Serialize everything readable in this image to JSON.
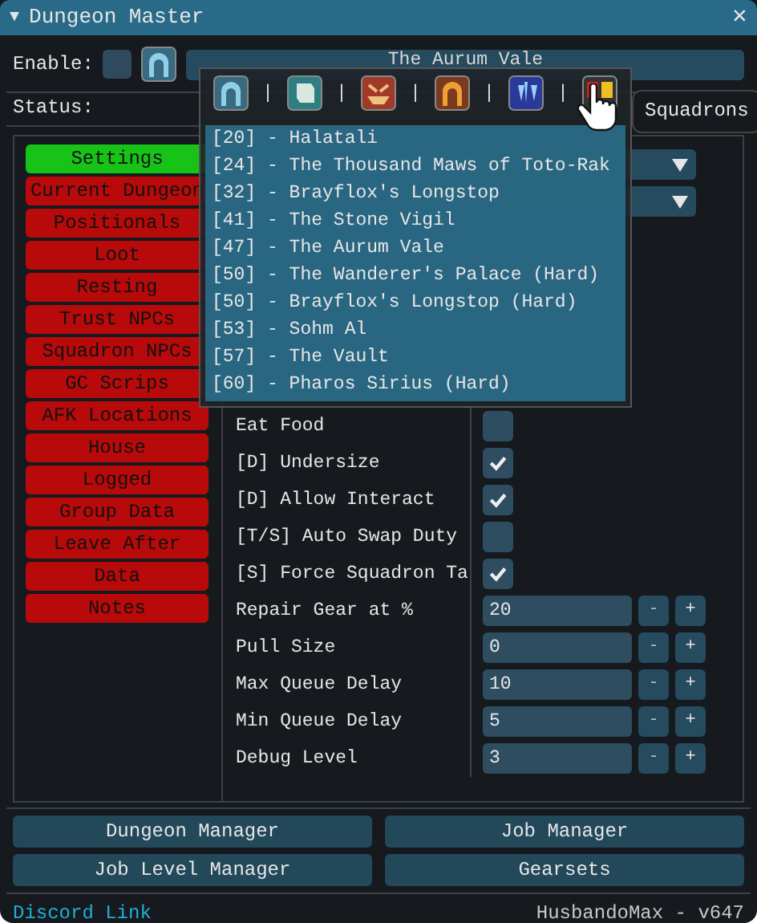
{
  "window": {
    "title": "Dungeon Master",
    "close": "×",
    "collapse": "▼"
  },
  "enable": {
    "label": "Enable:",
    "checked": false,
    "dungeon": "The Aurum Vale"
  },
  "status": {
    "label": "Status:"
  },
  "sidebar": [
    {
      "label": "Settings",
      "selected": true
    },
    {
      "label": "Current Dungeon",
      "selected": false
    },
    {
      "label": "Positionals",
      "selected": false
    },
    {
      "label": "Loot",
      "selected": false
    },
    {
      "label": "Resting",
      "selected": false
    },
    {
      "label": "Trust NPCs",
      "selected": false
    },
    {
      "label": "Squadron NPCs",
      "selected": false
    },
    {
      "label": "GC Scrips",
      "selected": false
    },
    {
      "label": "AFK Locations",
      "selected": false
    },
    {
      "label": "House",
      "selected": false
    },
    {
      "label": "Logged",
      "selected": false
    },
    {
      "label": "Group Data",
      "selected": false
    },
    {
      "label": "Leave After",
      "selected": false
    },
    {
      "label": "Data",
      "selected": false
    },
    {
      "label": "Notes",
      "selected": false
    }
  ],
  "settings": [
    {
      "kind": "checkbox",
      "label": "Eat Food",
      "checked": false
    },
    {
      "kind": "checkbox",
      "label": "[D] Undersize",
      "checked": true
    },
    {
      "kind": "checkbox",
      "label": "[D] Allow Interact",
      "checked": true
    },
    {
      "kind": "checkbox",
      "label": "[T/S] Auto Swap Duty",
      "checked": false
    },
    {
      "kind": "checkbox",
      "label": "[S] Force Squadron Ta",
      "checked": true
    },
    {
      "kind": "number",
      "label": "Repair Gear at %",
      "value": "20",
      "minus": "-",
      "plus": "+"
    },
    {
      "kind": "number",
      "label": "Pull Size",
      "value": "0",
      "minus": "-",
      "plus": "+"
    },
    {
      "kind": "number",
      "label": "Max Queue Delay",
      "value": "10",
      "minus": "-",
      "plus": "+"
    },
    {
      "kind": "number",
      "label": "Min Queue Delay",
      "value": "5",
      "minus": "-",
      "plus": "+"
    },
    {
      "kind": "number",
      "label": "Debug Level",
      "value": "3",
      "minus": "-",
      "plus": "+"
    }
  ],
  "popup": {
    "separators": [
      "|",
      "|",
      "|",
      "|",
      "|"
    ],
    "dungeons": [
      "[20] - Halatali",
      "[24] - The Thousand Maws of Toto-Rak",
      "[32] - Brayflox's Longstop",
      "[41] - The Stone Vigil",
      "[47] - The Aurum Vale",
      "[50] - The Wanderer's Palace (Hard)",
      "[50] - Brayflox's Longstop (Hard)",
      "[53] - Sohm Al",
      "[57] - The Vault",
      "[60] - Pharos Sirius (Hard)"
    ]
  },
  "tooltip": "Squadrons",
  "buttons": [
    "Dungeon Manager",
    "Job Manager",
    "Job Level Manager",
    "Gearsets"
  ],
  "footer": {
    "link": "Discord Link",
    "version": "HusbandoMax - v647"
  }
}
